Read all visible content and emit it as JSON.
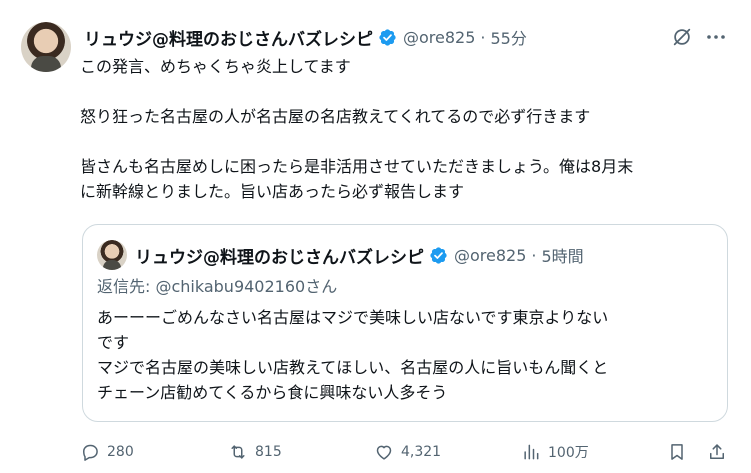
{
  "author": {
    "display_name": "リュウジ@料理のおじさんバズレシピ",
    "handle": "@ore825",
    "separator": "·",
    "time": "55分"
  },
  "tweet": {
    "line1": "この発言、めちゃくちゃ炎上してます",
    "line2": "怒り狂った名古屋の人が名古屋の名店教えてくれてるので必ず行きます",
    "line3": "皆さんも名古屋めしに困ったら是非活用させていただきましょう。俺は8月末",
    "line4": "に新幹線とりました。旨い店あったら必ず報告します"
  },
  "quote": {
    "display_name": "リュウジ@料理のおじさんバズレシピ",
    "handle": "@ore825",
    "separator": "·",
    "time": "5時間",
    "reply_to": "返信先: @chikabu9402160さん",
    "line1": "あーーーごめんなさい名古屋はマジで美味しい店ないです東京よりない",
    "line2": "です",
    "line3": "マジで名古屋の美味しい店教えてほしい、名古屋の人に旨いもん聞くと",
    "line4": "チェーン店勧めてくるから食に興味ない人多そう"
  },
  "actions": {
    "replies": "280",
    "reposts": "815",
    "likes": "4,321",
    "views": "100万"
  },
  "colors": {
    "text": "#0f1419",
    "secondary": "#536471",
    "verified_blue": "#1d9bf0",
    "border": "#cfd9de"
  },
  "icons": [
    "verified-badge-icon",
    "grok-icon",
    "more-icon",
    "reply-icon",
    "repost-icon",
    "like-icon",
    "views-icon",
    "bookmark-icon",
    "share-icon"
  ]
}
